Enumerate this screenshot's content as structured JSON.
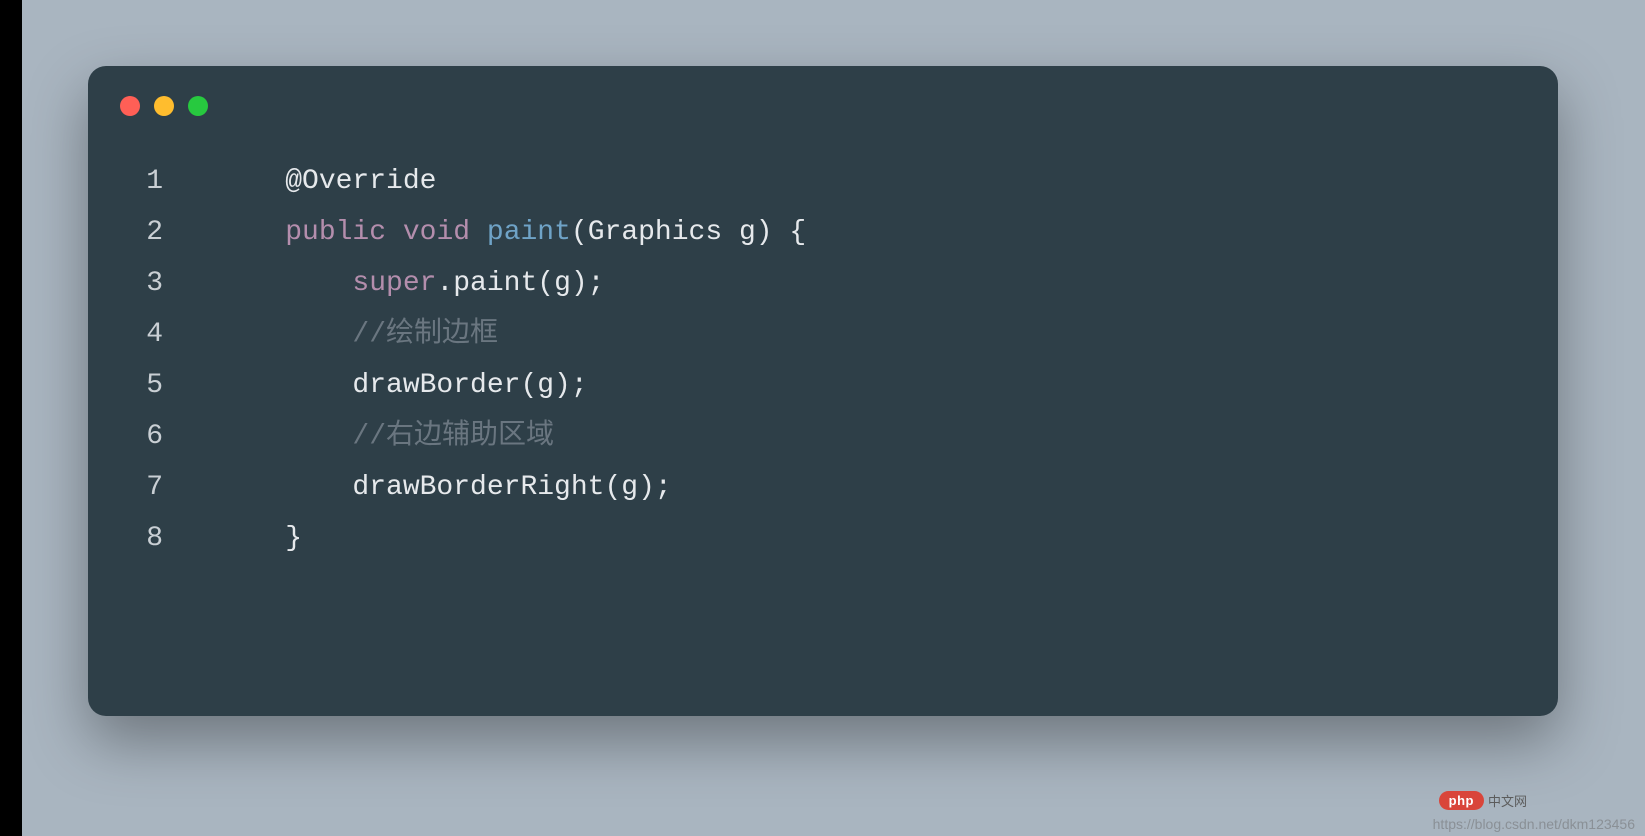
{
  "code": {
    "lines": [
      {
        "num": "1",
        "indent": "    ",
        "tokens": [
          {
            "cls": "tok-annotation",
            "text": "@Override"
          }
        ]
      },
      {
        "num": "2",
        "indent": "    ",
        "tokens": [
          {
            "cls": "tok-keyword",
            "text": "public"
          },
          {
            "cls": "",
            "text": " "
          },
          {
            "cls": "tok-keyword",
            "text": "void"
          },
          {
            "cls": "",
            "text": " "
          },
          {
            "cls": "tok-funcname",
            "text": "paint"
          },
          {
            "cls": "tok-punct",
            "text": "("
          },
          {
            "cls": "tok-type",
            "text": "Graphics g"
          },
          {
            "cls": "tok-punct",
            "text": ") {"
          }
        ]
      },
      {
        "num": "3",
        "indent": "        ",
        "tokens": [
          {
            "cls": "tok-super",
            "text": "super"
          },
          {
            "cls": "tok-punct",
            "text": "."
          },
          {
            "cls": "tok-call",
            "text": "paint(g);"
          }
        ]
      },
      {
        "num": "4",
        "indent": "        ",
        "tokens": [
          {
            "cls": "tok-comment",
            "text": "//绘制边框"
          }
        ]
      },
      {
        "num": "5",
        "indent": "        ",
        "tokens": [
          {
            "cls": "tok-call",
            "text": "drawBorder(g);"
          }
        ]
      },
      {
        "num": "6",
        "indent": "        ",
        "tokens": [
          {
            "cls": "tok-comment",
            "text": "//右边辅助区域"
          }
        ]
      },
      {
        "num": "7",
        "indent": "        ",
        "tokens": [
          {
            "cls": "tok-call",
            "text": "drawBorderRight(g);"
          }
        ]
      },
      {
        "num": "8",
        "indent": "    ",
        "tokens": [
          {
            "cls": "tok-punct",
            "text": "}"
          }
        ]
      }
    ]
  },
  "watermark": {
    "badge_label": "php",
    "badge_text": "中文网",
    "url": "https://blog.csdn.net/dkm123456"
  }
}
